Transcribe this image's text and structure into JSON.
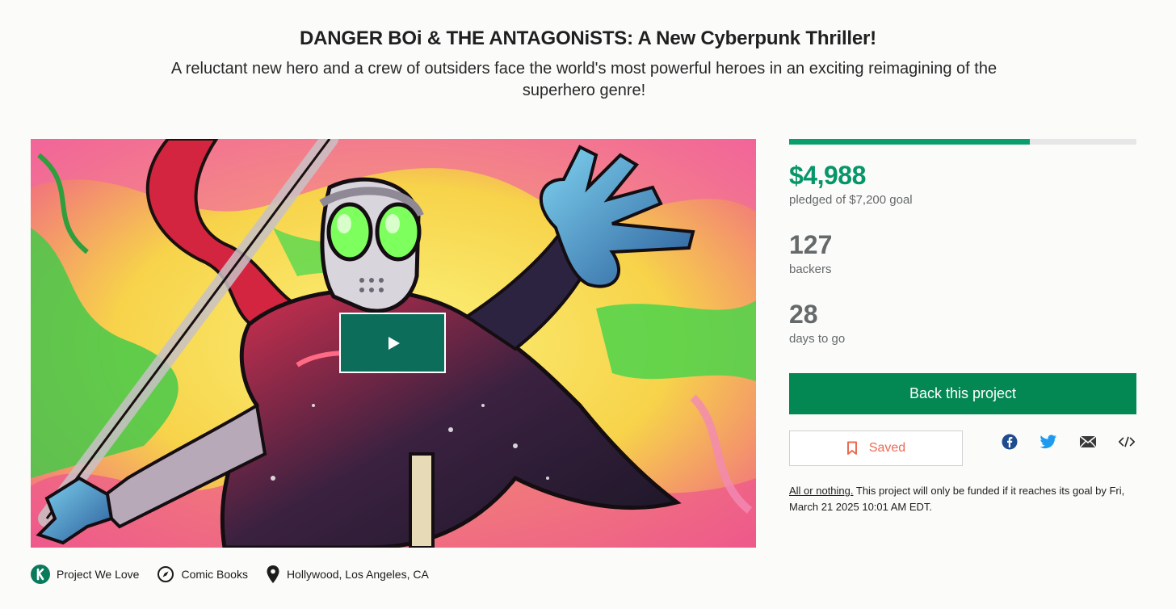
{
  "project": {
    "title": "DANGER BOi & THE ANTAGONiSTS: A New Cyberpunk Thriller!",
    "blurb": "A reluctant new hero and a crew of outsiders face the world's most powerful heroes in an exciting reimagining of the superhero genre!"
  },
  "media": {
    "play_icon": "play-icon",
    "colors": {
      "play_button_bg": "#0c6e5a"
    }
  },
  "tags": [
    {
      "icon": "kickstarter-badge-icon",
      "label": "Project We Love"
    },
    {
      "icon": "compass-icon",
      "label": "Comic Books"
    },
    {
      "icon": "location-pin-icon",
      "label": "Hollywood, Los Angeles, CA"
    }
  ],
  "funding": {
    "progress_fraction": 0.6928,
    "pledged": "$4,988",
    "pledged_caption": "pledged of $7,200 goal",
    "backers": "127",
    "backers_caption": "backers",
    "days": "28",
    "days_caption": "days to go"
  },
  "actions": {
    "back_label": "Back this project",
    "saved_label": "Saved",
    "share_icons": [
      "facebook-icon",
      "twitter-icon",
      "email-icon",
      "embed-icon"
    ]
  },
  "note": {
    "all_or_nothing": "All or nothing.",
    "text": " This project will only be funded if it reaches its goal by Fri, March 21 2025 10:01 AM EDT."
  },
  "colors": {
    "accent_green": "#079669",
    "button_green": "#038853",
    "saved_red": "#ec6a53",
    "muted_text": "#656969"
  }
}
